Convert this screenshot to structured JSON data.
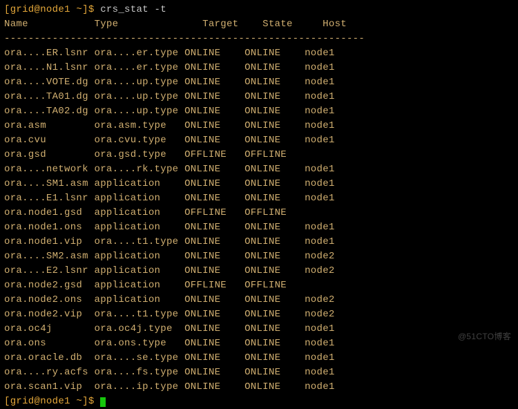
{
  "prompt": {
    "user": "grid",
    "host": "node1",
    "path": "~",
    "symbol": "$",
    "command": "crs_stat -t"
  },
  "headers": {
    "name": "Name",
    "type": "Type",
    "target": "Target",
    "state": "State",
    "host": "Host"
  },
  "separator": "------------------------------------------------------------",
  "rows": [
    {
      "name": "ora....ER.lsnr",
      "type": "ora....er.type",
      "target": "ONLINE",
      "state": "ONLINE",
      "host": "node1"
    },
    {
      "name": "ora....N1.lsnr",
      "type": "ora....er.type",
      "target": "ONLINE",
      "state": "ONLINE",
      "host": "node1"
    },
    {
      "name": "ora....VOTE.dg",
      "type": "ora....up.type",
      "target": "ONLINE",
      "state": "ONLINE",
      "host": "node1"
    },
    {
      "name": "ora....TA01.dg",
      "type": "ora....up.type",
      "target": "ONLINE",
      "state": "ONLINE",
      "host": "node1"
    },
    {
      "name": "ora....TA02.dg",
      "type": "ora....up.type",
      "target": "ONLINE",
      "state": "ONLINE",
      "host": "node1"
    },
    {
      "name": "ora.asm",
      "type": "ora.asm.type",
      "target": "ONLINE",
      "state": "ONLINE",
      "host": "node1"
    },
    {
      "name": "ora.cvu",
      "type": "ora.cvu.type",
      "target": "ONLINE",
      "state": "ONLINE",
      "host": "node1"
    },
    {
      "name": "ora.gsd",
      "type": "ora.gsd.type",
      "target": "OFFLINE",
      "state": "OFFLINE",
      "host": ""
    },
    {
      "name": "ora....network",
      "type": "ora....rk.type",
      "target": "ONLINE",
      "state": "ONLINE",
      "host": "node1"
    },
    {
      "name": "ora....SM1.asm",
      "type": "application",
      "target": "ONLINE",
      "state": "ONLINE",
      "host": "node1"
    },
    {
      "name": "ora....E1.lsnr",
      "type": "application",
      "target": "ONLINE",
      "state": "ONLINE",
      "host": "node1"
    },
    {
      "name": "ora.node1.gsd",
      "type": "application",
      "target": "OFFLINE",
      "state": "OFFLINE",
      "host": ""
    },
    {
      "name": "ora.node1.ons",
      "type": "application",
      "target": "ONLINE",
      "state": "ONLINE",
      "host": "node1"
    },
    {
      "name": "ora.node1.vip",
      "type": "ora....t1.type",
      "target": "ONLINE",
      "state": "ONLINE",
      "host": "node1"
    },
    {
      "name": "ora....SM2.asm",
      "type": "application",
      "target": "ONLINE",
      "state": "ONLINE",
      "host": "node2"
    },
    {
      "name": "ora....E2.lsnr",
      "type": "application",
      "target": "ONLINE",
      "state": "ONLINE",
      "host": "node2"
    },
    {
      "name": "ora.node2.gsd",
      "type": "application",
      "target": "OFFLINE",
      "state": "OFFLINE",
      "host": ""
    },
    {
      "name": "ora.node2.ons",
      "type": "application",
      "target": "ONLINE",
      "state": "ONLINE",
      "host": "node2"
    },
    {
      "name": "ora.node2.vip",
      "type": "ora....t1.type",
      "target": "ONLINE",
      "state": "ONLINE",
      "host": "node2"
    },
    {
      "name": "ora.oc4j",
      "type": "ora.oc4j.type",
      "target": "ONLINE",
      "state": "ONLINE",
      "host": "node1"
    },
    {
      "name": "ora.ons",
      "type": "ora.ons.type",
      "target": "ONLINE",
      "state": "ONLINE",
      "host": "node1"
    },
    {
      "name": "ora.oracle.db",
      "type": "ora....se.type",
      "target": "ONLINE",
      "state": "ONLINE",
      "host": "node1"
    },
    {
      "name": "ora....ry.acfs",
      "type": "ora....fs.type",
      "target": "ONLINE",
      "state": "ONLINE",
      "host": "node1"
    },
    {
      "name": "ora.scan1.vip",
      "type": "ora....ip.type",
      "target": "ONLINE",
      "state": "ONLINE",
      "host": "node1"
    }
  ],
  "watermark": "@51CTO博客",
  "col_widths": {
    "name": 15,
    "type": 15,
    "target": 10,
    "state": 10,
    "host": 10
  }
}
